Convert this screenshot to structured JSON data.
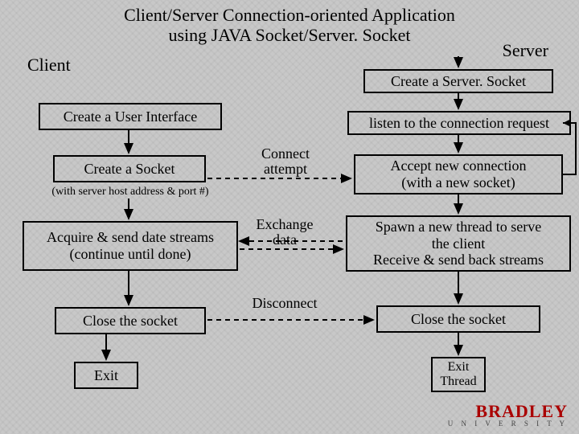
{
  "title_line1": "Client/Server Connection-oriented Application",
  "title_line2": "using JAVA Socket/Server. Socket",
  "client_label": "Client",
  "server_label": "Server",
  "client": {
    "step1": "Create a User Interface",
    "step2": "Create a Socket",
    "step2_note": "(with server host address & port #)",
    "step3_line1": "Acquire & send date streams",
    "step3_line2": "(continue until done)",
    "step4": "Close the socket",
    "step5": "Exit"
  },
  "server": {
    "step1": "Create a Server. Socket",
    "step2": "listen to the connection request",
    "step3_line1": "Accept new connection",
    "step3_line2": "(with a new socket)",
    "step4_line1": "Spawn a new thread to serve",
    "step4_line2": "the client",
    "step4_line3": "Receive & send back streams",
    "step5": "Close the socket",
    "step6_line1": "Exit",
    "step6_line2": "Thread"
  },
  "mid": {
    "connect_line1": "Connect",
    "connect_line2": "attempt",
    "exchange_line1": "Exchange",
    "exchange_line2": "data",
    "disconnect": "Disconnect"
  },
  "logo": {
    "name": "BRADLEY",
    "sub": "U N I V E R S I T Y"
  }
}
